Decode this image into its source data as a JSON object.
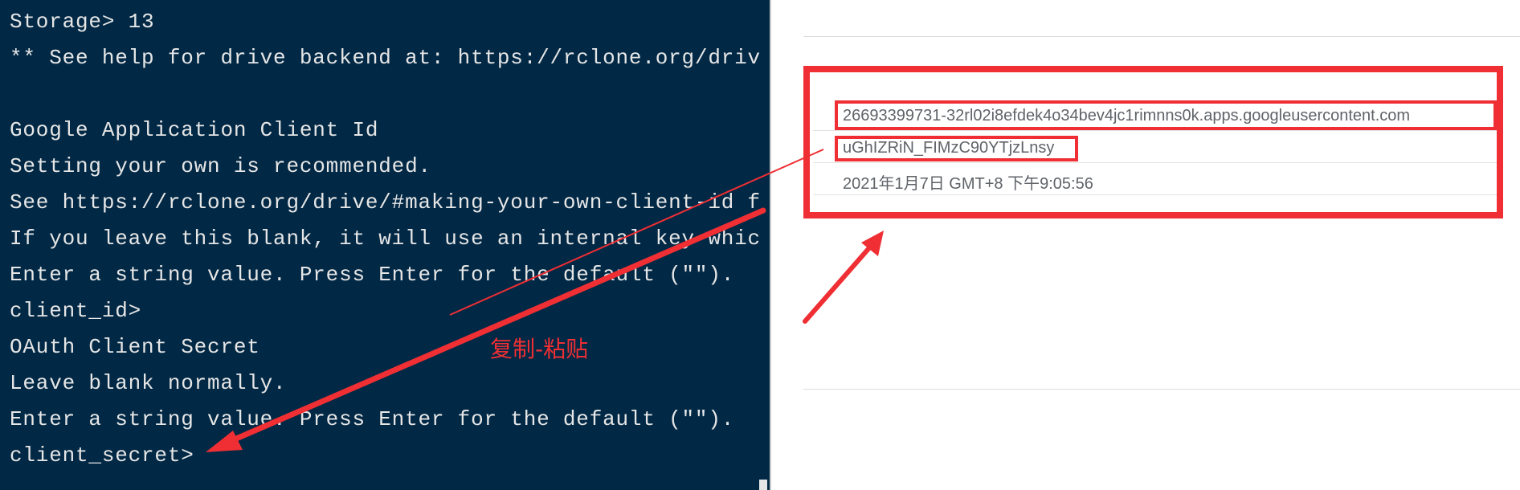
{
  "terminal": {
    "lines": [
      "Storage> 13",
      "** See help for drive backend at: https://rclone.org/driv",
      "",
      "Google Application Client Id",
      "Setting your own is recommended.",
      "See https://rclone.org/drive/#making-your-own-client-id f",
      "If you leave this blank, it will use an internal key whic",
      "Enter a string value. Press Enter for the default (\"\").",
      "client_id>",
      "OAuth Client Secret",
      "Leave blank normally.",
      "Enter a string value. Press Enter for the default (\"\").",
      "client_secret>"
    ]
  },
  "credentials": {
    "client_id": "26693399731-32rl02i8efdek4o34bev4jc1rimnns0k.apps.googleusercontent.com",
    "client_secret": "uGhIZRiN_FIMzC90YTjzLnsy",
    "created": "2021年1月7日 GMT+8 下午9:05:56"
  },
  "annotation": {
    "text": "复制-粘贴",
    "color": "#ef2f34"
  },
  "colors": {
    "terminal_bg": "#012845",
    "terminal_fg": "#e6e6e6",
    "highlight": "#ef2f34"
  }
}
